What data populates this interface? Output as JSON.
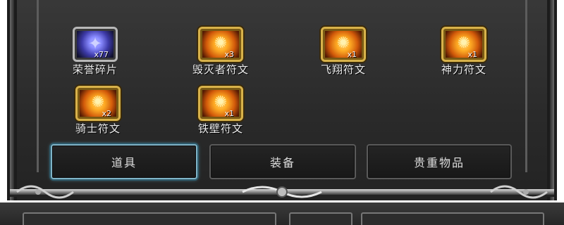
{
  "colors": {
    "panel_bg": "#2a2a2a",
    "frame_dark": "#1c1c1c",
    "text": "#ededed",
    "gold_border": "#d8b24a",
    "active_tab_border": "#7fb4c8"
  },
  "items": [
    {
      "name": "荣誉碎片",
      "count": "x77",
      "icon": "honor-shard-icon"
    },
    {
      "name": "毁灭者符文",
      "count": "x3",
      "icon": "destroyer-rune-icon"
    },
    {
      "name": "飞翔符文",
      "count": "x1",
      "icon": "flight-rune-icon"
    },
    {
      "name": "神力符文",
      "count": "x1",
      "icon": "divine-power-rune-icon"
    },
    {
      "name": "骑士符文",
      "count": "x2",
      "icon": "knight-rune-icon"
    },
    {
      "name": "铁壁符文",
      "count": "x1",
      "icon": "iron-wall-rune-icon"
    }
  ],
  "tabs": [
    {
      "label": "道具",
      "active": true
    },
    {
      "label": "装备",
      "active": false
    },
    {
      "label": "贵重物品",
      "active": false
    }
  ]
}
